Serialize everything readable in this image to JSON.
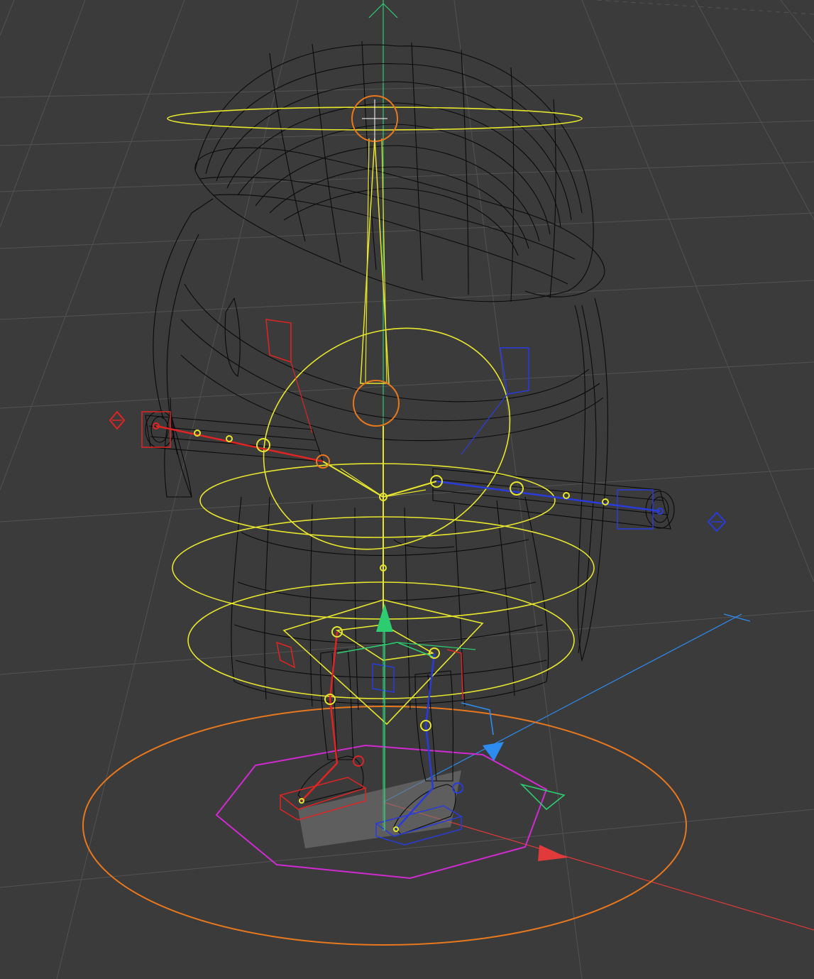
{
  "viewport": {
    "background": "#3b3b3b",
    "grid_color": "#4f4f4f",
    "wire_color": "#0a0a0a"
  },
  "rig_colors": {
    "spine": "#e6e62e",
    "left_limb": "#e02424",
    "right_limb": "#2a3bdc",
    "root_circle": "#e8781e",
    "foot_ground": "#d02bd0",
    "axis_x": "#e03a3a",
    "axis_y": "#2ecc71",
    "axis_z": "#2d8cf0"
  },
  "icons": {
    "left_controller": "diamond-marker-icon",
    "right_controller": "diamond-marker-icon",
    "gizmo_x": "arrow-x-icon",
    "gizmo_y": "arrow-y-icon",
    "gizmo_z": "arrow-z-icon"
  }
}
